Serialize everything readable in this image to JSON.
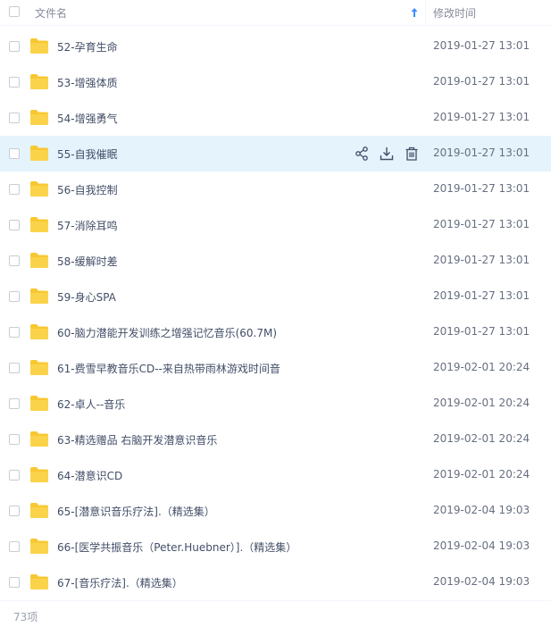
{
  "header": {
    "name_label": "文件名",
    "time_label": "修改时间",
    "sort_icon": "arrow-up-icon"
  },
  "colors": {
    "folder": "#f8c832",
    "hover_row": "#e5f3fd",
    "sort_accent": "#3b8cff"
  },
  "rows": [
    {
      "name": "52-孕育生命",
      "time": "2019-01-27 13:01"
    },
    {
      "name": "53-增强体质",
      "time": "2019-01-27 13:01"
    },
    {
      "name": "54-增强勇气",
      "time": "2019-01-27 13:01"
    },
    {
      "name": "55-自我催眠",
      "time": "2019-01-27 13:01"
    },
    {
      "name": "56-自我控制",
      "time": "2019-01-27 13:01"
    },
    {
      "name": "57-消除耳鸣",
      "time": "2019-01-27 13:01"
    },
    {
      "name": "58-缓解时差",
      "time": "2019-01-27 13:01"
    },
    {
      "name": "59-身心SPA",
      "time": "2019-01-27 13:01"
    },
    {
      "name": "60-脑力潜能开发训练之增强记忆音乐(60.7M)",
      "time": "2019-01-27 13:01"
    },
    {
      "name": "61-费雪早教音乐CD--来自热带雨林游戏时间音",
      "time": "2019-02-01 20:24"
    },
    {
      "name": "62-卓人--音乐",
      "time": "2019-02-01 20:24"
    },
    {
      "name": "63-精选赠品 右脑开发潜意识音乐",
      "time": "2019-02-01 20:24"
    },
    {
      "name": "64-潜意识CD",
      "time": "2019-02-01 20:24"
    },
    {
      "name": "65-[潜意识音乐疗法].（精选集）",
      "time": "2019-02-04 19:03"
    },
    {
      "name": "66-[医学共振音乐（Peter.Huebner）].（精选集）",
      "time": "2019-02-04 19:03"
    },
    {
      "name": "67-[音乐疗法].（精选集）",
      "time": "2019-02-04 19:03"
    }
  ],
  "hover_actions": [
    "share-icon",
    "download-icon",
    "delete-icon"
  ],
  "footer": {
    "count": "73项"
  }
}
